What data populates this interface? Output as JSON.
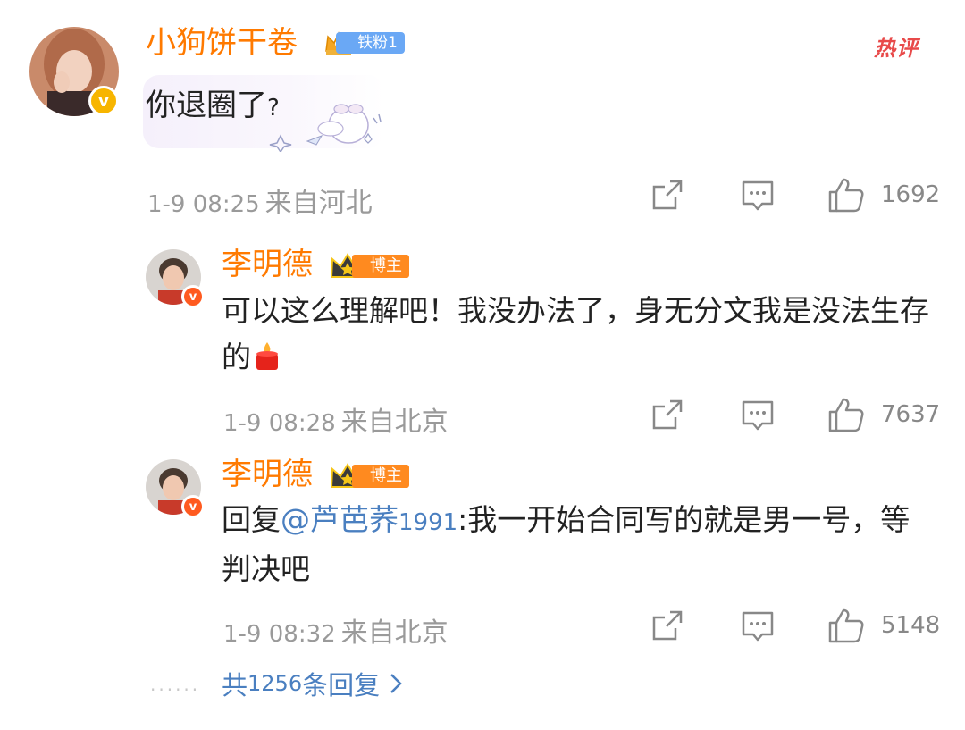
{
  "hot_label": "热评",
  "main_comment": {
    "username": "小狗饼干卷",
    "fan_badge": "铁粉1",
    "text": "你退圈了",
    "text_mark": "?",
    "time": "1-9 08:25",
    "location": "来自河北",
    "likes": "1692"
  },
  "replies": [
    {
      "username": "李明德",
      "badge": "博主",
      "text": "可以这么理解吧！我没办法了，身无分文我是没法生存的",
      "time": "1-9 08:28",
      "location": "来自北京",
      "likes": "7637"
    },
    {
      "username": "李明德",
      "badge": "博主",
      "reply_prefix": "回复",
      "mention": "@芦芭荞",
      "mention_num": "1991",
      "text": ":我一开始合同写的就是男一号，等判决吧",
      "time": "1-9 08:32",
      "location": "来自北京",
      "likes": "5148"
    }
  ],
  "more_replies": {
    "prefix": "共",
    "count": "1256",
    "suffix": "条回复",
    "dots": "......"
  },
  "colors": {
    "username": "#ff7a00",
    "mention": "#4a7fc0",
    "meta": "#9a9a9a",
    "hot": "#e84a4a"
  }
}
